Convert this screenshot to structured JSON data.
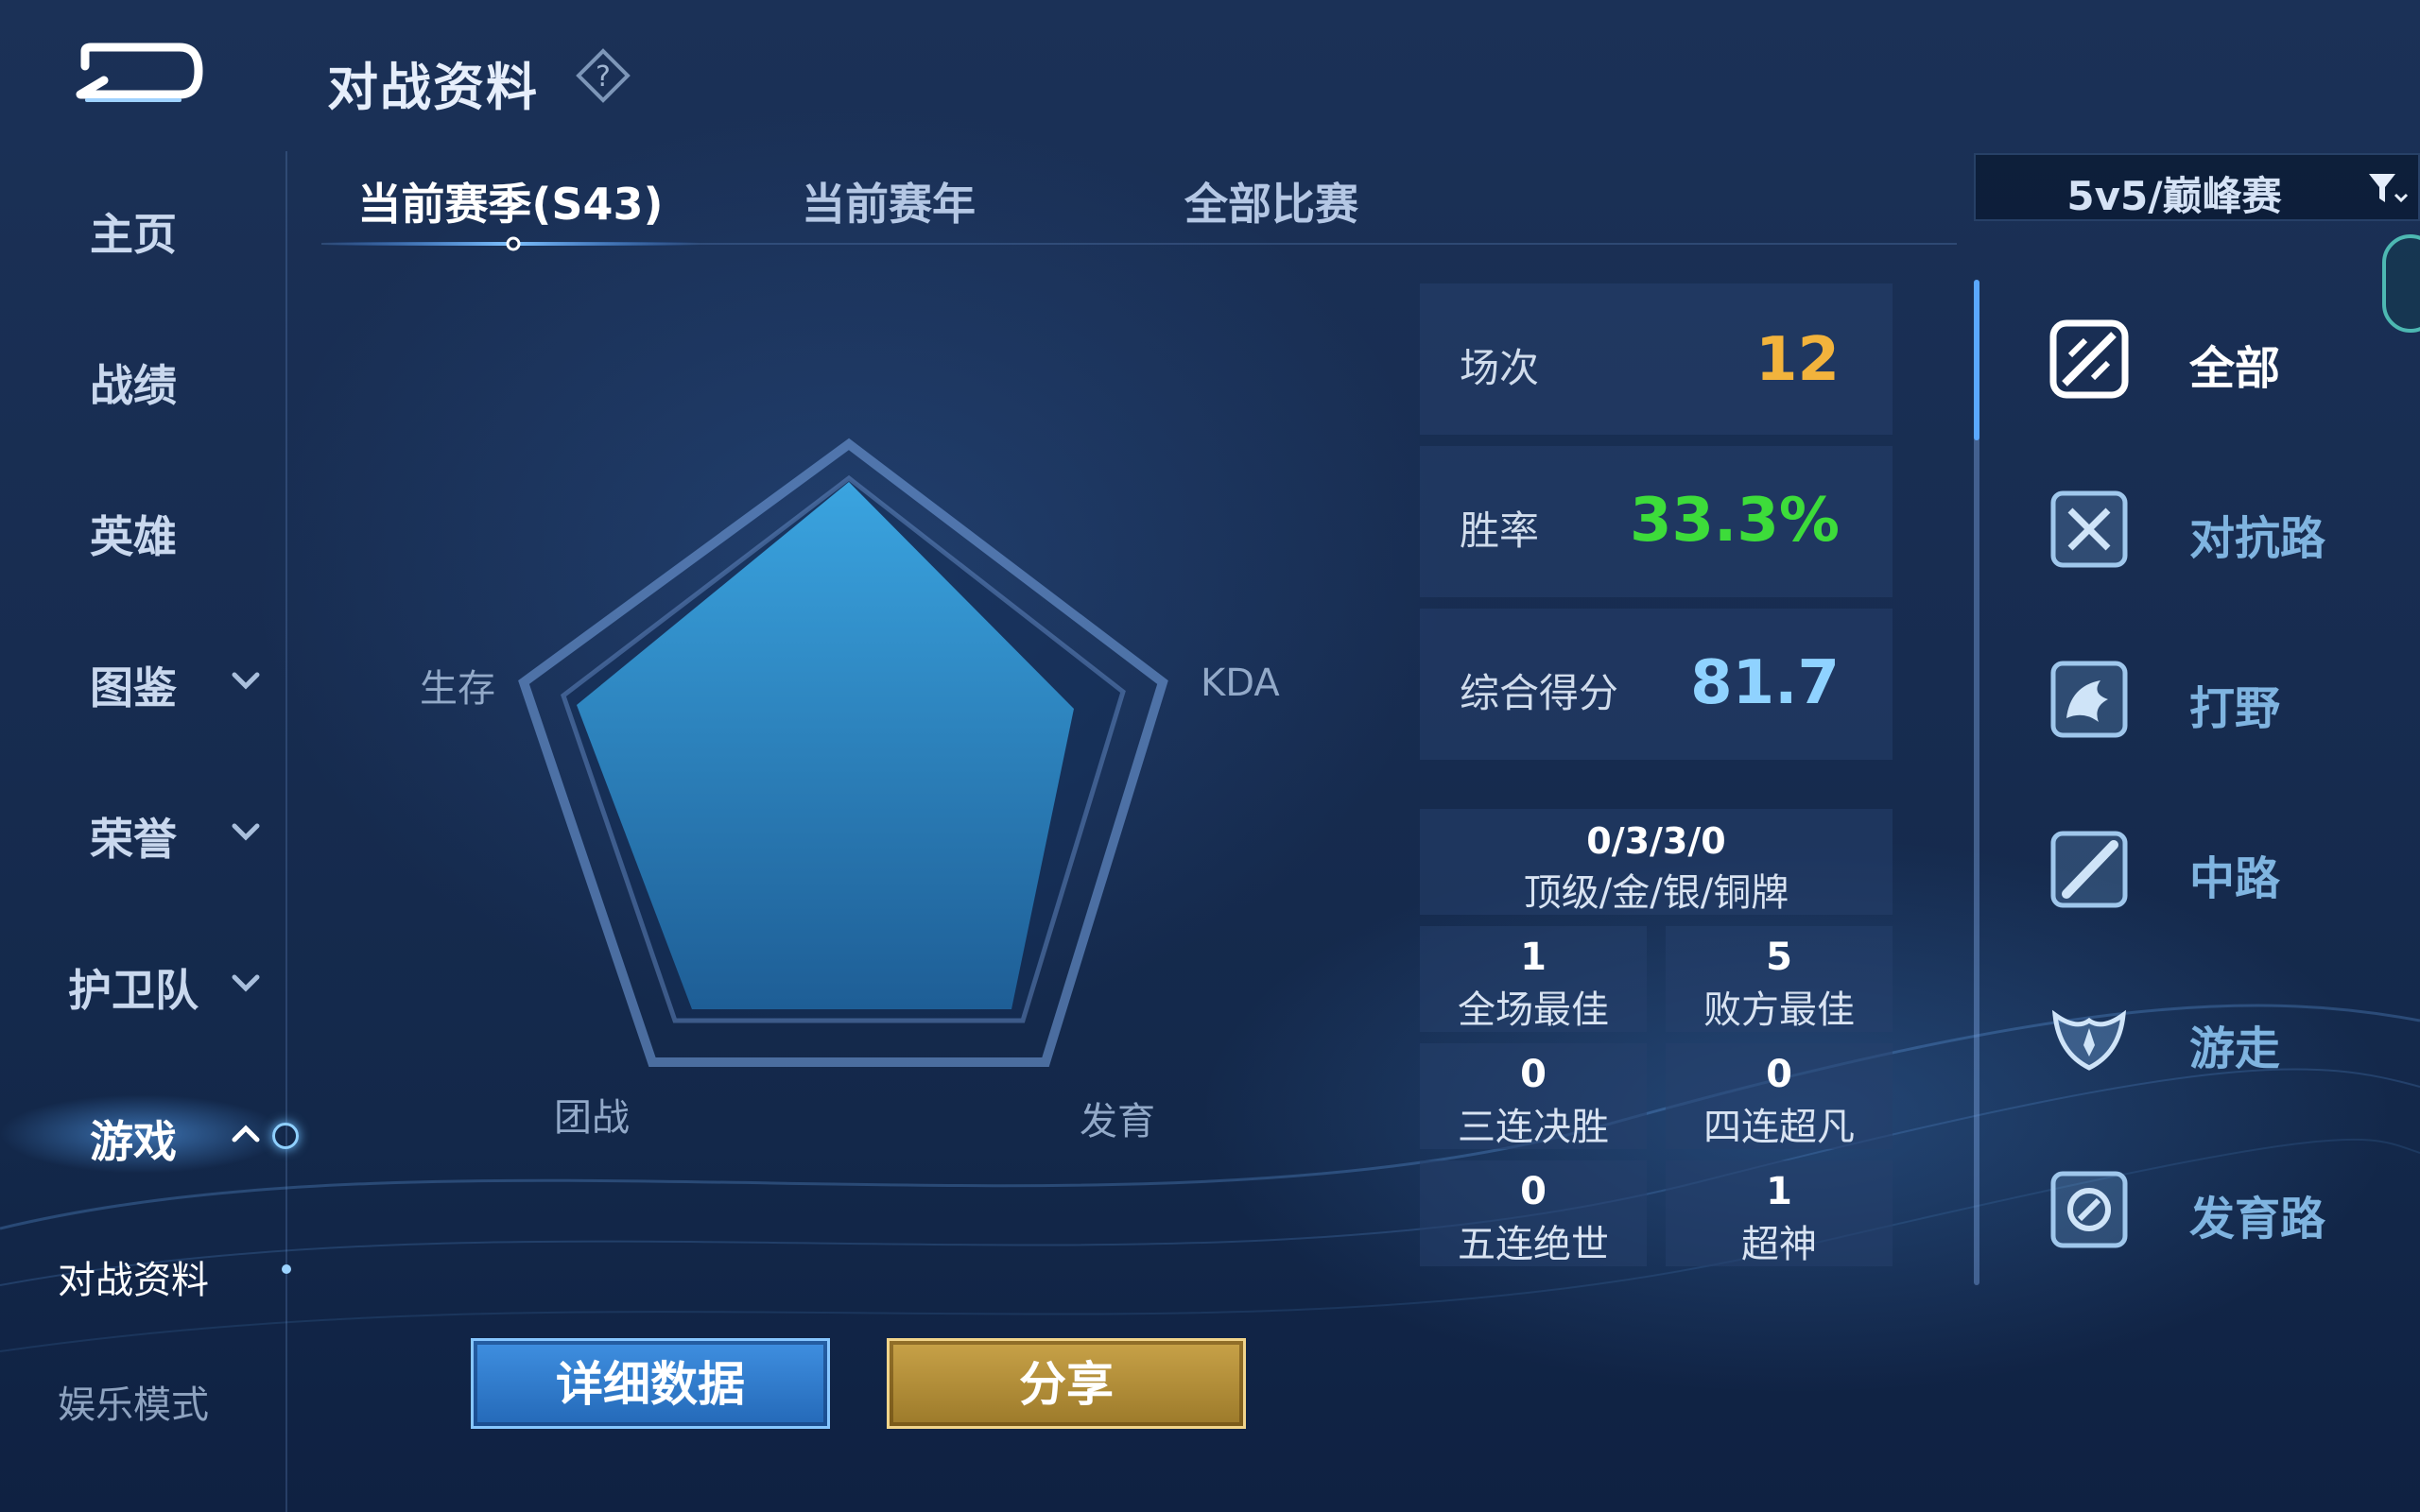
{
  "header": {
    "title": "对战资料",
    "help_icon": "question-diamond-icon"
  },
  "sidebar": {
    "items": [
      {
        "label": "主页"
      },
      {
        "label": "战绩"
      },
      {
        "label": "英雄"
      },
      {
        "label": "图鉴"
      },
      {
        "label": "荣誉"
      },
      {
        "label": "护卫队"
      },
      {
        "label": "游戏"
      }
    ],
    "sub_items": [
      {
        "label": "对战资料"
      },
      {
        "label": "娱乐模式"
      }
    ]
  },
  "tabs": [
    {
      "label": "当前赛季(S43)"
    },
    {
      "label": "当前赛年"
    },
    {
      "label": "全部比赛"
    }
  ],
  "filter": {
    "label": "5v5/巅峰赛"
  },
  "radar": {
    "labels": {
      "survival": "生存",
      "kda": "KDA",
      "teamfight": "团战",
      "development": "发育"
    }
  },
  "stats": {
    "matches": {
      "label": "场次",
      "value": "12",
      "color": "#f2b33c"
    },
    "win_rate": {
      "label": "胜率",
      "value": "33.3%",
      "color": "#3ddc3a"
    },
    "score": {
      "label": "综合得分",
      "value": "81.7",
      "color": "#8fd2ff"
    }
  },
  "medals": {
    "value": "0/3/3/0",
    "label": "顶级/金/银/铜牌"
  },
  "achievements": [
    {
      "value": "1",
      "label": "全场最佳"
    },
    {
      "value": "5",
      "label": "败方最佳"
    },
    {
      "value": "0",
      "label": "三连决胜"
    },
    {
      "value": "0",
      "label": "四连超凡"
    },
    {
      "value": "0",
      "label": "五连绝世"
    },
    {
      "value": "1",
      "label": "超神"
    }
  ],
  "lanes": [
    {
      "label": "全部",
      "icon": "all-lanes-icon"
    },
    {
      "label": "对抗路",
      "icon": "clash-lane-icon"
    },
    {
      "label": "打野",
      "icon": "jungle-icon"
    },
    {
      "label": "中路",
      "icon": "mid-lane-icon"
    },
    {
      "label": "游走",
      "icon": "roam-icon"
    },
    {
      "label": "发育路",
      "icon": "farm-lane-icon"
    }
  ],
  "buttons": {
    "details": "详细数据",
    "share": "分享"
  }
}
